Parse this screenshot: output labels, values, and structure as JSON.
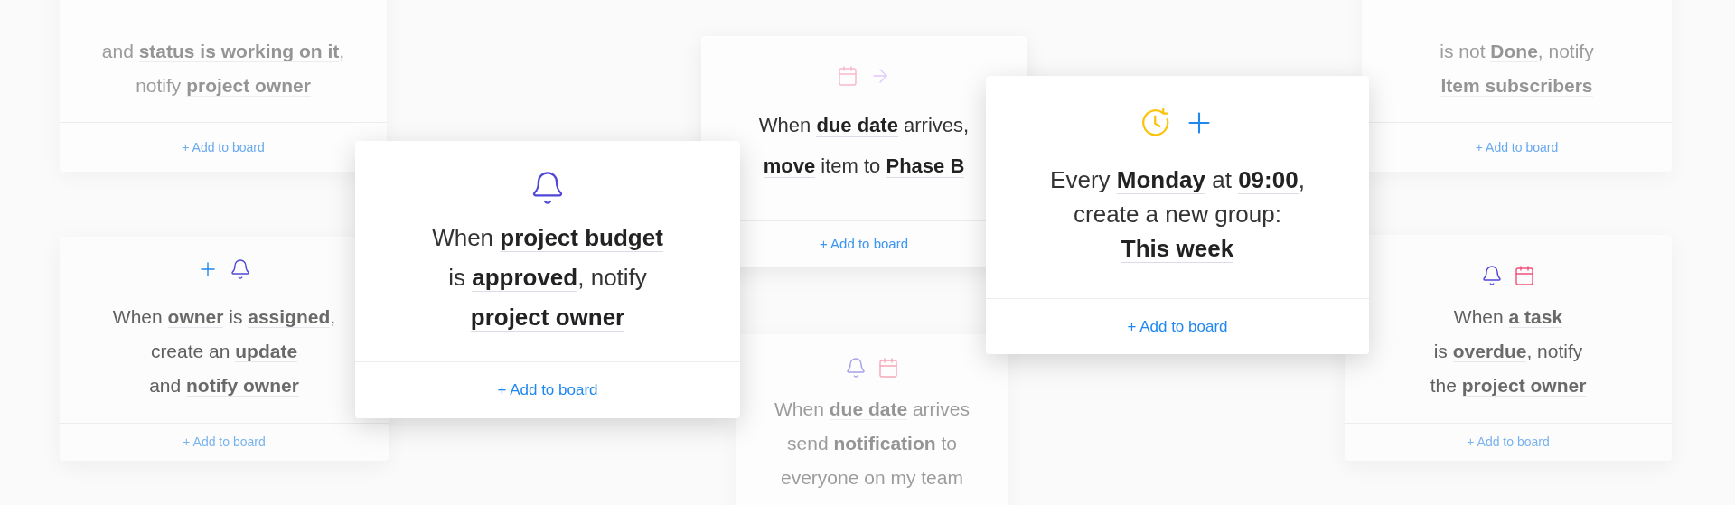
{
  "cards": [
    {
      "kind": "faint",
      "lines": [
        "and **status is working on it**,",
        "notify **project owner**"
      ],
      "action": "+ Add to board"
    },
    {
      "kind": "muted",
      "icons": [
        {
          "kind": "plus"
        },
        {
          "kind": "bell"
        }
      ],
      "lines": [
        "When **owner** is **assigned**,",
        "create an **update**",
        "and **notify owner**"
      ],
      "action": "+ Add to board"
    },
    {
      "kind": "focused",
      "icons": [
        {
          "kind": "bell"
        }
      ],
      "lines": [
        "When **project budget**",
        "is **approved**, notify",
        "**project owner**"
      ],
      "action": "+ Add to board"
    },
    {
      "kind": "plain",
      "icons": [
        {
          "kind": "calendar"
        },
        {
          "kind": "arrow"
        }
      ],
      "lines": [
        "When **due date** arrives,",
        "**move** item to **Phase B**"
      ],
      "action": "+ Add to board"
    },
    {
      "kind": "faint",
      "icons": [
        {
          "kind": "bell"
        },
        {
          "kind": "calendar"
        }
      ],
      "lines": [
        "When **due date** arrives",
        "send **notification** to",
        "everyone on my team"
      ]
    },
    {
      "kind": "focused",
      "icons": [
        {
          "kind": "clock"
        },
        {
          "kind": "plus"
        }
      ],
      "lines": [
        "Every **Monday** at **09:00**,",
        "create a new group:",
        "**This week**"
      ],
      "action": "+ Add to board"
    },
    {
      "kind": "faint",
      "lines": [
        "is not **Done**, notify",
        "**Item subscribers**"
      ],
      "action": "+ Add to board"
    },
    {
      "kind": "muted",
      "icons": [
        {
          "kind": "bell"
        },
        {
          "kind": "calendar"
        }
      ],
      "lines": [
        "When **a task**",
        "is **overdue**, notify",
        "the **project owner**"
      ],
      "action": "+ Add to board"
    }
  ]
}
